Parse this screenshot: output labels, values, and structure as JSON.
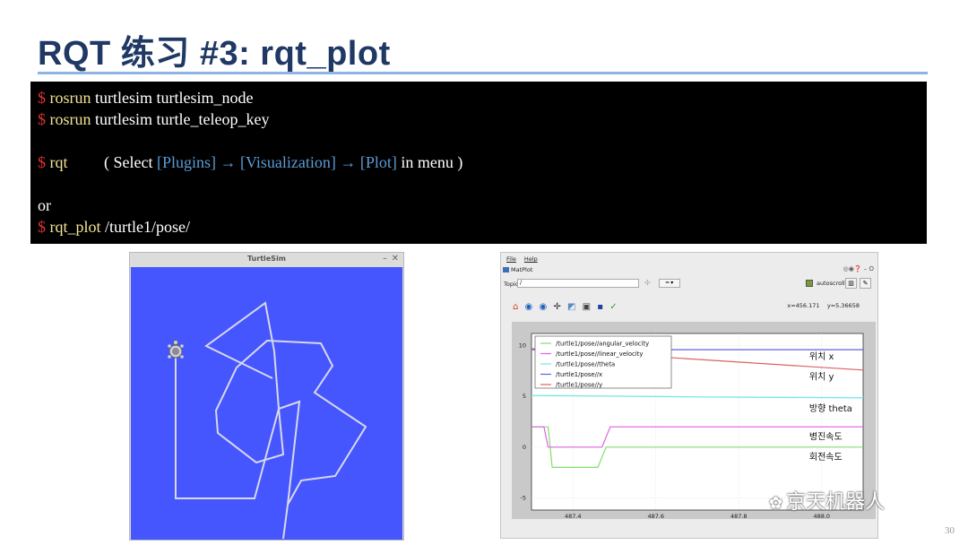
{
  "slide": {
    "title": "RQT 练习 #3: rqt_plot",
    "page_number": "30"
  },
  "terminal": {
    "line1": {
      "prompt": "$ ",
      "cmd": "rosrun",
      "rest": " turtlesim turtlesim_node"
    },
    "line2": {
      "prompt": "$ ",
      "cmd": "rosrun",
      "rest": " turtlesim turtle_teleop_key"
    },
    "line3": {
      "prompt": "$ ",
      "cmd": "rqt",
      "gap": "         ( Select ",
      "plugins": "[Plugins]",
      "arrow1": " → ",
      "visualization": "[Visualization]",
      "arrow2": " → ",
      "plot": "[Plot]",
      "suffix": " in menu )"
    },
    "line4": {
      "text": "or"
    },
    "line5": {
      "prompt": "$ ",
      "cmd": "rqt_plot",
      "rest": " /turtle1/pose/"
    }
  },
  "turtlesim": {
    "window_title": "TurtleSim",
    "minimize": "–",
    "close": "✕",
    "bg_color": "#4556ff",
    "path_color": "#d8d8e8"
  },
  "matplot": {
    "menu_file": "File",
    "menu_help": "Help",
    "plugin_title": "MatPlot",
    "header_icons": "◎◉❓ –  O",
    "topic_label": "Topic",
    "topic_value": "/",
    "add_icon": "✣",
    "dropdown": "━ ▾",
    "autoscroll_label": "autoscroll",
    "coord_x": "x=456.171",
    "coord_y": "y=5.36658",
    "toolbar_icons": [
      "home-icon",
      "back-icon",
      "forward-icon",
      "pan-icon",
      "zoom-icon",
      "configure-icon",
      "save-icon",
      "check-icon"
    ],
    "watermark": "京天机器人"
  },
  "chart_data": {
    "type": "line",
    "xlim": [
      487.3,
      488.1
    ],
    "ylim": [
      -6.2,
      11.2
    ],
    "xticks": [
      "487.4",
      "487.6",
      "487.8",
      "488.0"
    ],
    "xtick_values": [
      487.4,
      487.6,
      487.8,
      488.0
    ],
    "yticks": [
      "10",
      "5",
      "0",
      "-5"
    ],
    "ytick_values": [
      10,
      5,
      0,
      -5
    ],
    "grid": true,
    "legend_position": "top-left",
    "series": [
      {
        "name": "/turtle1/pose//angular_velocity",
        "color": "#7ee06a",
        "x": [
          487.3,
          487.34,
          487.35,
          487.46,
          487.48,
          488.1
        ],
        "y": [
          2.0,
          2.0,
          -2.0,
          -2.0,
          0.0,
          0.0
        ]
      },
      {
        "name": "/turtle1/pose//linear_velocity",
        "color": "#e060e0",
        "x": [
          487.3,
          487.33,
          487.34,
          487.47,
          487.49,
          488.1
        ],
        "y": [
          2.0,
          2.0,
          0.0,
          0.0,
          2.0,
          2.0
        ]
      },
      {
        "name": "/turtle1/pose//theta",
        "color": "#6de8e8",
        "x": [
          487.3,
          487.7,
          488.1
        ],
        "y": [
          5.1,
          4.95,
          4.85
        ]
      },
      {
        "name": "/turtle1/pose//x",
        "color": "#6060e0",
        "x": [
          487.3,
          488.1
        ],
        "y": [
          9.6,
          9.6
        ]
      },
      {
        "name": "/turtle1/pose//y",
        "color": "#e06060",
        "x": [
          487.3,
          488.1
        ],
        "y": [
          9.7,
          7.6
        ]
      }
    ],
    "annotations": [
      {
        "text": "위치 x",
        "x": 487.97,
        "y": 8.9
      },
      {
        "text": "위치 y",
        "x": 487.97,
        "y": 6.9
      },
      {
        "text": "방향 theta",
        "x": 487.97,
        "y": 3.8
      },
      {
        "text": "병진속도",
        "x": 487.97,
        "y": 1.0
      },
      {
        "text": "회전속도",
        "x": 487.97,
        "y": -1.0
      }
    ]
  }
}
